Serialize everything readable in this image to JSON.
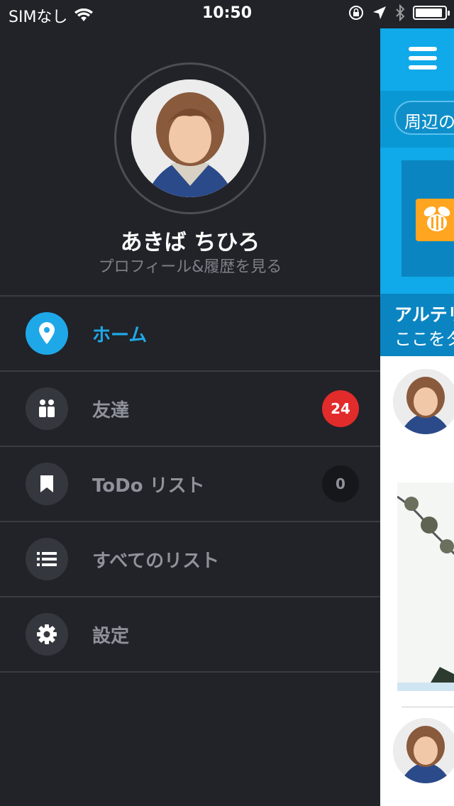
{
  "status_bar": {
    "carrier": "SIMなし",
    "time": "10:50",
    "battery_level": 0.92
  },
  "profile": {
    "name": "あきば ちひろ",
    "subtitle": "プロフィール&履歴を見る"
  },
  "menu": {
    "items": [
      {
        "label": "ホーム",
        "icon": "location-pin-icon",
        "active": true
      },
      {
        "label": "友達",
        "icon": "friends-icon",
        "badge": "24"
      },
      {
        "label": "ToDo リスト",
        "icon": "bookmark-icon",
        "badge": "0"
      },
      {
        "label": "すべてのリスト",
        "icon": "list-icon"
      },
      {
        "label": "設定",
        "icon": "gear-icon"
      }
    ]
  },
  "content": {
    "search_pill": "周辺の",
    "announce_title": "アルテリ",
    "announce_sub": "ここをタ"
  },
  "colors": {
    "accent": "#1fa8e8",
    "drawer_bg": "#212328",
    "badge_red": "#e22b2b"
  }
}
